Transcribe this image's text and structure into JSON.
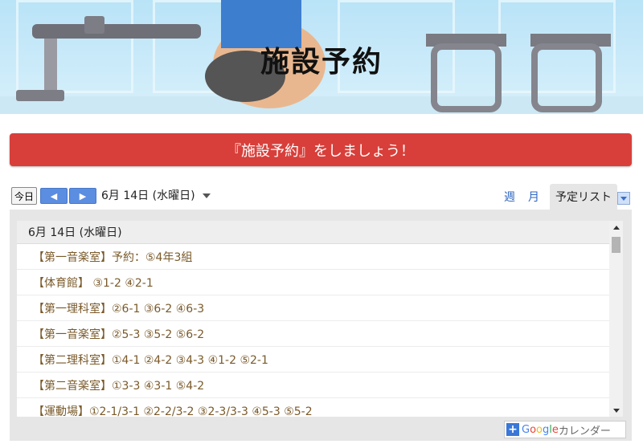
{
  "banner": {
    "title": "施設予約"
  },
  "cta": {
    "text": "『施設予約』をしましょう！"
  },
  "calendar": {
    "today_button": "今日",
    "prev_button": "◀",
    "next_button": "▶",
    "current_date": "6月 14日 (水曜日)",
    "tabs": {
      "week": "週",
      "month": "月",
      "agenda": "予定リスト"
    },
    "agenda": {
      "date_header": "6月 14日 (水曜日)",
      "events": [
        "【第一音楽室】予約：⑤4年3組",
        "【体育館】 ③1-2 ④2-1",
        "【第一理科室】②6-1 ③6-2 ④6-3",
        "【第一音楽室】②5-3 ③5-2 ⑤6-2",
        "【第二理科室】①4-1 ②4-2 ③4-3 ④1-2 ⑤2-1",
        "【第二音楽室】①3-3 ④3-1 ⑤4-2",
        "【運動場】①2-1/3-1 ②2-2/3-2 ③2-3/3-3 ④5-3 ⑤5-2"
      ]
    },
    "google_button": {
      "plus": "+",
      "g": "G",
      "o1": "o",
      "o2": "o",
      "g2": "g",
      "l": "l",
      "e": "e",
      "label": "カレンダー"
    }
  }
}
